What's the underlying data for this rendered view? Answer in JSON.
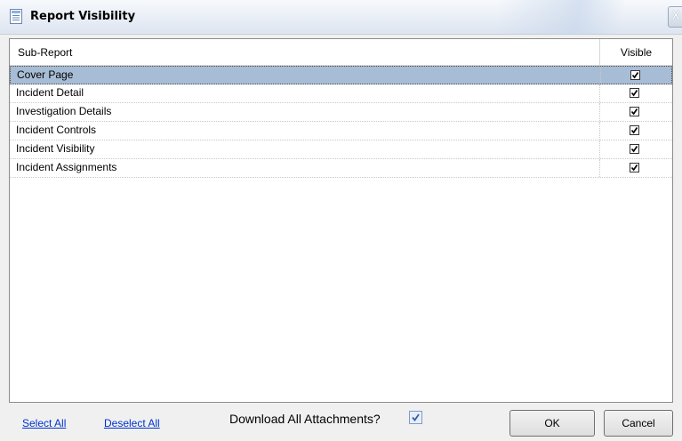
{
  "window": {
    "title": "Report Visibility",
    "title_icon": "report-icon",
    "close_icon": "close-icon",
    "close_glyph": "X"
  },
  "grid": {
    "columns": {
      "sub_report": "Sub-Report",
      "visible": "Visible"
    },
    "rows": [
      {
        "name": "Cover Page",
        "visible": true,
        "selected": true
      },
      {
        "name": "Incident Detail",
        "visible": true,
        "selected": false
      },
      {
        "name": "Investigation Details",
        "visible": true,
        "selected": false
      },
      {
        "name": "Incident Controls",
        "visible": true,
        "selected": false
      },
      {
        "name": "Incident Visibility",
        "visible": true,
        "selected": false
      },
      {
        "name": "Incident Assignments",
        "visible": true,
        "selected": false
      }
    ]
  },
  "footer": {
    "select_all": "Select All",
    "deselect_all": "Deselect All",
    "download_label": "Download All Attachments?",
    "download_checked": true,
    "ok": "OK",
    "cancel": "Cancel"
  },
  "colors": {
    "selection": "#a7bcd5",
    "link": "#0033cc"
  }
}
